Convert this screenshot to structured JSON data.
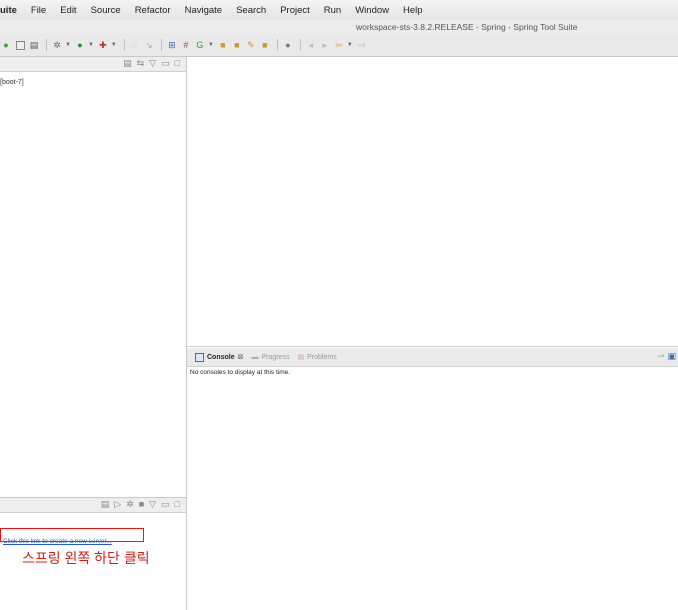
{
  "menubar": {
    "app_label": "uite",
    "items": [
      "File",
      "Edit",
      "Source",
      "Refactor",
      "Navigate",
      "Search",
      "Project",
      "Run",
      "Window",
      "Help"
    ]
  },
  "window": {
    "title": "workspace-sts-3.8.2.RELEASE - Spring - Spring Tool Suite"
  },
  "toolbar": {
    "icons": [
      "new-icon",
      "save-icon",
      "print-icon",
      "debug-icon",
      "run-icon",
      "external-tools-icon",
      "search-icon",
      "open-type-icon",
      "spring-icon",
      "folder-icon",
      "edit-icon",
      "back-icon",
      "forward-icon"
    ]
  },
  "explorer": {
    "tree_item": "[boot-7]"
  },
  "servers": {
    "create_link": "Click this link to create a new server..."
  },
  "annotation": {
    "text": "스프링 왼쪽 하단 클릭"
  },
  "console": {
    "tabs": [
      {
        "label": "Console",
        "active": true
      },
      {
        "label": "Progress",
        "active": false
      },
      {
        "label": "Problems",
        "active": false
      }
    ],
    "message": "No consoles to display at this time."
  },
  "colors": {
    "annotation": "#c8201f",
    "link": "#2a5db0",
    "highlight_border": "#d62020"
  }
}
